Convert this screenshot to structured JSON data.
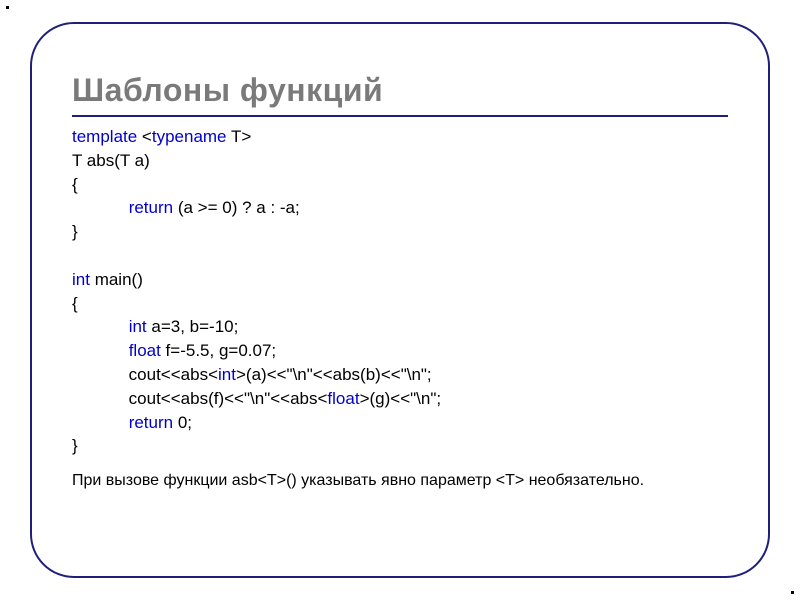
{
  "title": "Шаблоны функций",
  "code": {
    "l01a": "template",
    "l01b": " <",
    "l01c": "typename",
    "l01d": " T>",
    "l02": "T abs(T a)",
    "l03": "{",
    "l04a": "            ",
    "l04b": "return",
    "l04c": " (a >= 0) ? a : -a;",
    "l05": "}",
    "l06": "",
    "l07a": "int",
    "l07b": " main()",
    "l08": "{",
    "l09a": "            ",
    "l09b": "int",
    "l09c": " a=3, b=-10;",
    "l10a": "            ",
    "l10b": "float",
    "l10c": " f=-5.5, g=0.07;",
    "l11a": "            cout<<abs<",
    "l11b": "int",
    "l11c": ">(a)<<\"\\n\"<<abs(b)<<\"\\n\";",
    "l12a": "            cout<<abs(f)<<\"\\n\"<<abs<",
    "l12b": "float",
    "l12c": ">(g)<<\"\\n\";",
    "l13a": "            ",
    "l13b": "return",
    "l13c": " 0;",
    "l14": "}"
  },
  "note": "При вызове функции asb<T>() указывать явно параметр <T> необязательно."
}
